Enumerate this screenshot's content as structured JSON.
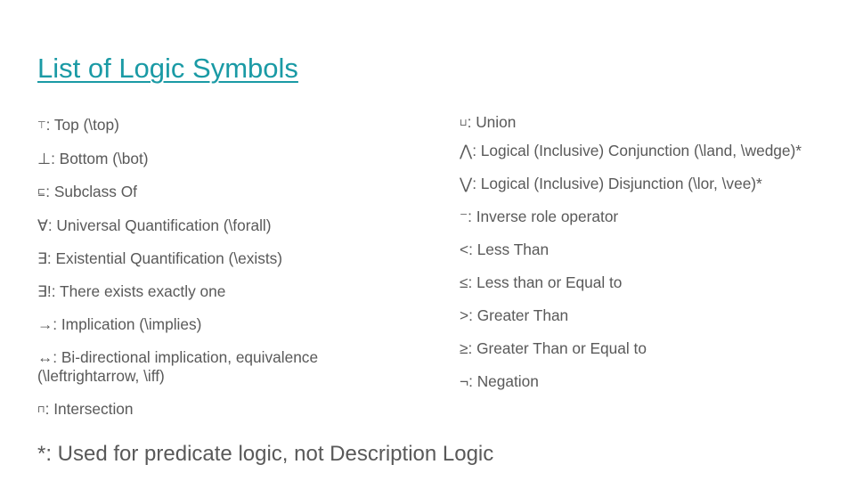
{
  "title": {
    "text": "List of Logic Symbols",
    "color": "#1a9aa5"
  },
  "left_items": [
    {
      "symbol": "⊤",
      "text": ": Top (\\top)"
    },
    {
      "symbol": "⊥",
      "text": ": Bottom (\\bot)"
    },
    {
      "symbol": "⊑",
      "text": ": Subclass Of"
    },
    {
      "symbol": "∀",
      "text": ": Universal Quantification (\\forall)"
    },
    {
      "symbol": "∃",
      "text": ": Existential Quantification (\\exists)"
    },
    {
      "symbol": "∃",
      "text": "!: There exists exactly one"
    },
    {
      "symbol": "→",
      "text": ": Implication (\\implies)"
    },
    {
      "symbol": "↔",
      "text": ": Bi-directional implication, equivalence (\\leftrightarrow, \\iff)"
    },
    {
      "symbol": "⊓",
      "text": ": Intersection"
    }
  ],
  "right_items": [
    {
      "symbol": "⊔",
      "text": ": Union"
    },
    {
      "symbol": "⋀",
      "text": ": Logical (Inclusive) Conjunction (\\land, \\wedge)*"
    },
    {
      "symbol": "⋁",
      "text": ": Logical (Inclusive) Disjunction (\\lor, \\vee)*"
    },
    {
      "symbol": "⁻",
      "text": ": Inverse role operator"
    },
    {
      "symbol": "<",
      "text": ": Less Than"
    },
    {
      "symbol": "≤",
      "text": ": Less than or Equal to"
    },
    {
      "symbol": ">",
      "text": ": Greater Than"
    },
    {
      "symbol": "≥",
      "text": ": Greater Than or Equal to"
    },
    {
      "symbol": "¬",
      "text": ": Negation"
    }
  ],
  "footnote": "*: Used for predicate logic, not Description Logic"
}
